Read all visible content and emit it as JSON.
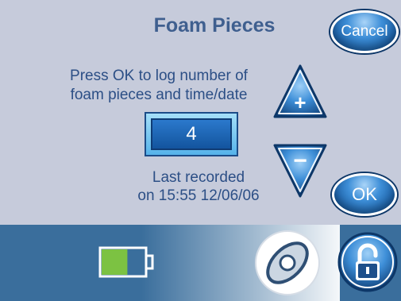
{
  "header": {
    "title": "Foam Pieces",
    "cancel_label": "Cancel"
  },
  "main": {
    "instruction_line1": "Press OK to log number of",
    "instruction_line2": "foam pieces and time/date",
    "count": "4",
    "last_recorded_line1": "Last recorded",
    "last_recorded_line2": "on 15:55 12/06/06",
    "ok_label": "OK",
    "increment_symbol": "+",
    "decrement_symbol": "−"
  },
  "footer": {
    "battery_level": 0.6
  },
  "icons": [
    "battery-icon",
    "slide-to-unlock-handle",
    "lock-icon",
    "up-arrow-icon",
    "down-arrow-icon"
  ],
  "colors": {
    "background": "#c6cbdb",
    "title_text": "#3f5f8f",
    "body_text": "#2c4f86",
    "button_blue": "#1b5fa5",
    "battery_green": "#7cc242",
    "bar": "#3a6e9c"
  }
}
